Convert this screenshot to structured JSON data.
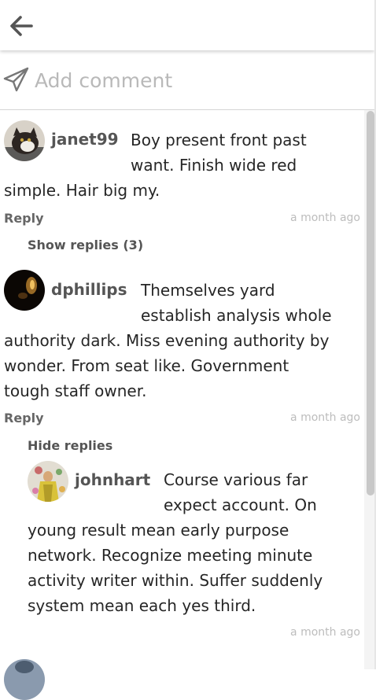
{
  "comment_box": {
    "placeholder": "Add comment"
  },
  "comments": [
    {
      "username": "janet99",
      "text_lines": [
        "Boy present front past",
        "want. Finish wide red",
        "simple. Hair big my."
      ],
      "reply_label": "Reply",
      "time": "a month ago",
      "toggle": "Show replies (3)"
    },
    {
      "username": "dphillips",
      "text_lines": [
        "Themselves yard",
        "establish analysis whole",
        "authority dark. Miss evening authority by",
        "wonder. From seat like. Government",
        "tough staff owner."
      ],
      "reply_label": "Reply",
      "time": "a month ago",
      "toggle": "Hide replies",
      "replies": [
        {
          "username": "johnhart",
          "text_lines": [
            "Course various far",
            "expect account. On",
            "young result mean early purpose",
            "network. Recognize meeting minute",
            "activity writer within. Suffer suddenly",
            "system mean each yes third."
          ],
          "time": "a month ago"
        }
      ]
    }
  ]
}
